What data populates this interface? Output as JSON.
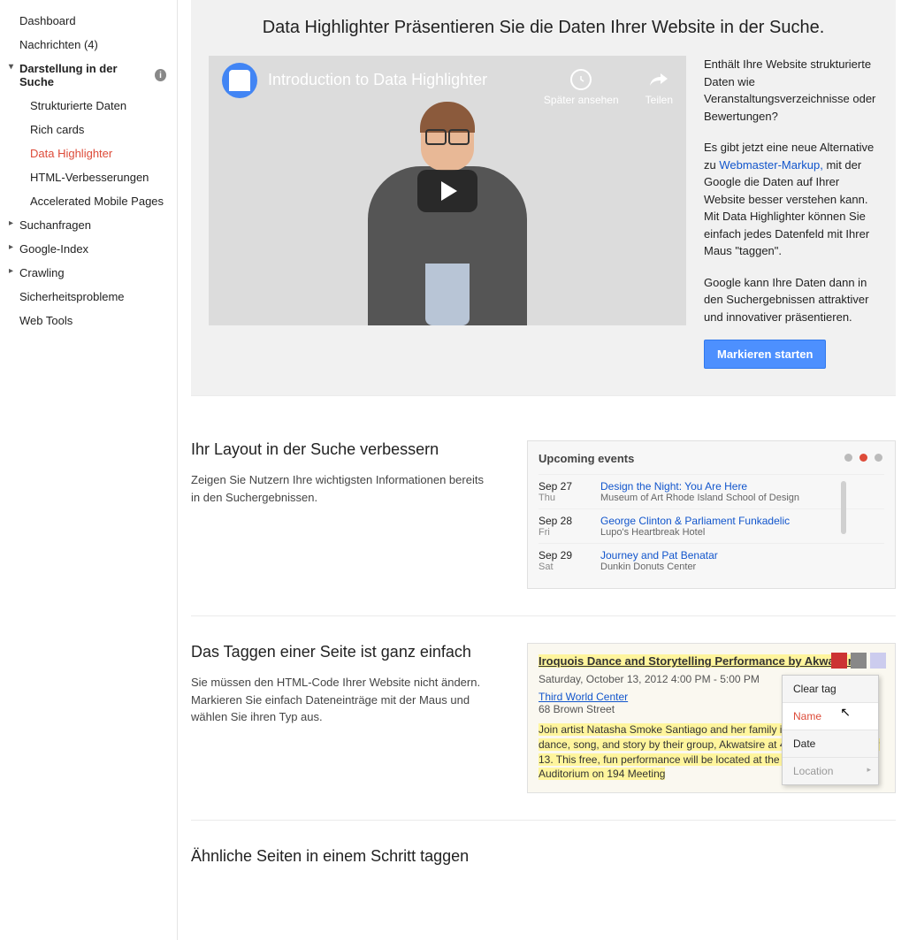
{
  "sidebar": {
    "dashboard": "Dashboard",
    "nachrichten": "Nachrichten (4)",
    "darstellung": {
      "label": "Darstellung in der Suche",
      "items": [
        "Strukturierte Daten",
        "Rich cards",
        "Data Highlighter",
        "HTML-Verbesserungen",
        "Accelerated Mobile Pages"
      ]
    },
    "suchanfragen": "Suchanfragen",
    "google_index": "Google-Index",
    "crawling": "Crawling",
    "sicherheit": "Sicherheitsprobleme",
    "web_tools": "Web Tools"
  },
  "hero": {
    "title": "Data Highlighter Präsentieren Sie die Daten Ihrer Website in der Suche.",
    "video_title": "Introduction to Data Highlighter",
    "later": "Später ansehen",
    "share": "Teilen",
    "p1": "Enthält Ihre Website strukturierte Daten wie Veranstaltungsverzeichnisse oder Bewertungen?",
    "p2a": "Es gibt jetzt eine neue Alternative zu ",
    "p2_link": "Webmaster-Markup,",
    "p2b": " mit der Google die Daten auf Ihrer Website besser verstehen kann. Mit Data Highlighter können Sie einfach jedes Datenfeld mit Ihrer Maus \"taggen\".",
    "p3": "Google kann Ihre Daten dann in den Suchergebnissen attraktiver und innovativer präsentieren.",
    "cta": "Markieren starten"
  },
  "sec1": {
    "h": "Ihr Layout in der Suche verbessern",
    "p": "Zeigen Sie Nutzern Ihre wichtigsten Informationen bereits in den Suchergebnissen.",
    "events_header": "Upcoming events",
    "events": [
      {
        "date": "Sep 27",
        "day": "Thu",
        "title": "Design the Night: You Are Here",
        "venue": "Museum of Art Rhode Island School of Design"
      },
      {
        "date": "Sep 28",
        "day": "Fri",
        "title": "George Clinton & Parliament Funkadelic",
        "venue": "Lupo's Heartbreak Hotel"
      },
      {
        "date": "Sep 29",
        "day": "Sat",
        "title": "Journey and Pat Benatar",
        "venue": "Dunkin Donuts Center"
      }
    ]
  },
  "sec2": {
    "h": "Das Taggen einer Seite ist ganz einfach",
    "p": "Sie müssen den HTML-Code Ihrer Website nicht ändern. Markieren Sie einfach Dateneinträge mit der Maus und wählen Sie ihren Typ aus.",
    "tag_title": "Iroquois Dance and Storytelling Performance by Akwatsire!",
    "tag_date": "Saturday, October 13, 2012 4:00 PM - 5:00 PM",
    "tag_loc": "Third World Center",
    "tag_addr": "68 Brown Street",
    "tag_desc": "Join artist Natasha Smoke Santiago and her family in authentic Iroquois dance, song, and story by their group, Akwatsire at 4:00 p.m. on October 13. This free, fun performance will be located at the Alumnae Hall Auditorium on 194 Meeting",
    "menu": {
      "clear": "Clear tag",
      "name": "Name",
      "date": "Date",
      "loc": "Location"
    }
  },
  "sec3": {
    "h": "Ähnliche Seiten in einem Schritt taggen"
  }
}
